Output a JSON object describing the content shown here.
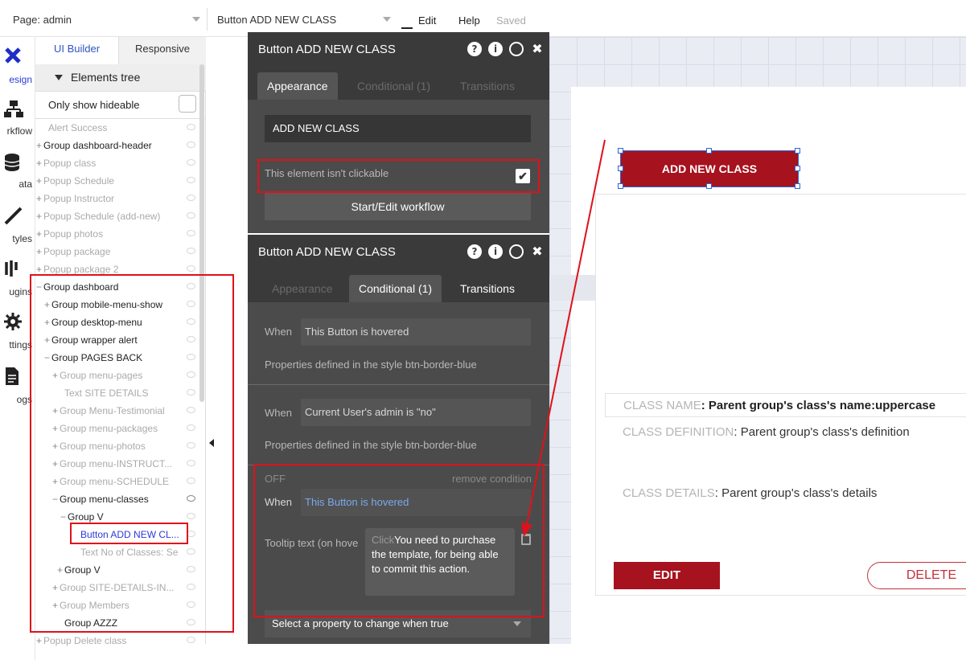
{
  "topbar": {
    "page_select": "Page: admin",
    "element_select": "Button ADD NEW CLASS",
    "menu_edit": "Edit",
    "menu_help": "Help",
    "saved_status": "Saved"
  },
  "iconbar": {
    "items": [
      {
        "label": "esign",
        "icon": "design-icon"
      },
      {
        "label": "rkflow",
        "icon": "workflow-icon"
      },
      {
        "label": "ata",
        "icon": "data-icon"
      },
      {
        "label": "tyles",
        "icon": "styles-icon"
      },
      {
        "label": "ugins",
        "icon": "plugins-icon"
      },
      {
        "label": "ttings",
        "icon": "settings-icon"
      },
      {
        "label": "ogs",
        "icon": "logs-icon"
      }
    ]
  },
  "tree": {
    "tab_ui": "UI Builder",
    "tab_responsive": "Responsive",
    "header": "Elements tree",
    "only_hideable": "Only show hideable",
    "rows": [
      {
        "text": "Alert Success",
        "prefix": "",
        "tone": "gray"
      },
      {
        "text": "Group dashboard-header",
        "prefix": "+",
        "tone": "dark"
      },
      {
        "text": "Popup class",
        "prefix": "+",
        "tone": "gray"
      },
      {
        "text": "Popup Schedule",
        "prefix": "+",
        "tone": "gray"
      },
      {
        "text": "Popup Instructor",
        "prefix": "+",
        "tone": "gray"
      },
      {
        "text": "Popup Schedule (add-new)",
        "prefix": "+",
        "tone": "gray"
      },
      {
        "text": "Popup photos",
        "prefix": "+",
        "tone": "gray"
      },
      {
        "text": "Popup package",
        "prefix": "+",
        "tone": "gray"
      },
      {
        "text": "Popup package 2",
        "prefix": "+",
        "tone": "gray"
      },
      {
        "text": "Group dashboard",
        "prefix": "−",
        "tone": "dark"
      },
      {
        "text": "Group mobile-menu-show",
        "prefix": "+",
        "tone": "dark"
      },
      {
        "text": "Group desktop-menu",
        "prefix": "+",
        "tone": "dark"
      },
      {
        "text": "Group wrapper alert",
        "prefix": "+",
        "tone": "dark"
      },
      {
        "text": "Group PAGES BACK",
        "prefix": "−",
        "tone": "dark"
      },
      {
        "text": "Group menu-pages",
        "prefix": "+",
        "tone": "gray"
      },
      {
        "text": "Text SITE DETAILS",
        "prefix": "",
        "tone": "gray"
      },
      {
        "text": "Group Menu-Testimonial",
        "prefix": "+",
        "tone": "gray"
      },
      {
        "text": "Group menu-packages",
        "prefix": "+",
        "tone": "gray"
      },
      {
        "text": "Group menu-photos",
        "prefix": "+",
        "tone": "gray"
      },
      {
        "text": "Group menu-INSTRUCT...",
        "prefix": "+",
        "tone": "gray"
      },
      {
        "text": "Group menu-SCHEDULE",
        "prefix": "+",
        "tone": "gray"
      },
      {
        "text": "Group menu-classes",
        "prefix": "−",
        "tone": "dark"
      },
      {
        "text": "Group V",
        "prefix": "−",
        "tone": "dark"
      },
      {
        "text": "Button ADD NEW CL...",
        "prefix": "",
        "tone": "sel"
      },
      {
        "text": "Text No of Classes: Se",
        "prefix": "",
        "tone": "gray"
      },
      {
        "text": "Group V",
        "prefix": "+",
        "tone": "dark"
      },
      {
        "text": "Group SITE-DETAILS-IN...",
        "prefix": "+",
        "tone": "gray"
      },
      {
        "text": "Group Members",
        "prefix": "+",
        "tone": "gray"
      },
      {
        "text": "Group AZZZ",
        "prefix": "",
        "tone": "dark"
      },
      {
        "text": "Popup Delete class",
        "prefix": "+",
        "tone": "gray"
      }
    ]
  },
  "panel1": {
    "title": "Button ADD NEW CLASS",
    "tabs": [
      "Appearance",
      "Conditional (1)",
      "Transitions"
    ],
    "text_value": "ADD NEW CLASS",
    "not_clickable_label": "This element isn't clickable",
    "checkbox_mark": "✔",
    "workflow_button": "Start/Edit workflow"
  },
  "panel2": {
    "title": "Button ADD NEW CLASS",
    "tabs": [
      "Appearance",
      "Conditional (1)",
      "Transitions"
    ],
    "cond1_when": "When",
    "cond1_value": "This Button is hovered",
    "cond1_props": "Properties defined in the style btn-border-blue",
    "cond2_when": "When",
    "cond2_value": "Current User's admin is \"no\"",
    "cond2_props": "Properties defined in the style btn-border-blue",
    "cond3_off": "OFF",
    "cond3_remove": "remove condition",
    "cond3_when": "When",
    "cond3_value": "This Button is hovered",
    "tooltip_label": "Tooltip text (on hove",
    "tooltip_pre": "Click",
    "tooltip_text": "You need to purchase the template, for being able to commit this action.",
    "select_property": "Select a property to change when true"
  },
  "canvas": {
    "add_button": "ADD NEW CLASS",
    "class_name_label": "CLASS NAME",
    "class_name_value": ": Parent group's class's name:uppercase",
    "class_def_label": "CLASS DEFINITION",
    "class_def_value": ":  Parent group's class's definition",
    "class_details_label": "CLASS DETAILS",
    "class_details_value": ":  Parent group's class's details",
    "edit_button": "EDIT",
    "delete_button": "DELETE"
  },
  "colors": {
    "brand_red": "#a6121e",
    "annotation_red": "#e0111a",
    "panel_dark": "#4b4b4b",
    "selection_blue": "#2a3ad6"
  }
}
